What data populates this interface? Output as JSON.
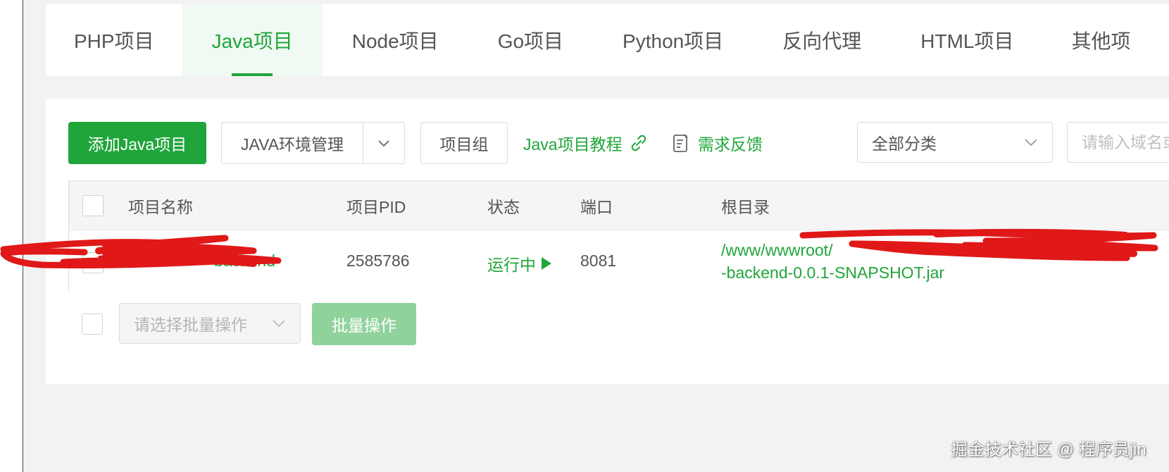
{
  "tabs": [
    {
      "label": "PHP项目",
      "active": false
    },
    {
      "label": "Java项目",
      "active": true
    },
    {
      "label": "Node项目",
      "active": false
    },
    {
      "label": "Go项目",
      "active": false
    },
    {
      "label": "Python项目",
      "active": false
    },
    {
      "label": "反向代理",
      "active": false
    },
    {
      "label": "HTML项目",
      "active": false
    },
    {
      "label": "其他项",
      "active": false
    }
  ],
  "toolbar": {
    "add_button": "添加Java项目",
    "env_manage": "JAVA环境管理",
    "project_group": "项目组",
    "tutorial_link": "Java项目教程",
    "feedback_link": "需求反馈",
    "category_select": "全部分类",
    "search_placeholder": "请输入域名或"
  },
  "table": {
    "headers": {
      "name": "项目名称",
      "pid": "项目PID",
      "status": "状态",
      "port": "端口",
      "root": "根目录"
    },
    "rows": [
      {
        "name": "backend",
        "pid": "2585786",
        "status": "运行中",
        "port": "8081",
        "root_line1": "/www/wwwroot/",
        "root_line2": "-backend-0.0.1-SNAPSHOT.jar"
      }
    ]
  },
  "batch": {
    "select_placeholder": "请选择批量操作",
    "button": "批量操作"
  },
  "watermark": "掘金技术社区 @ 程序员jin",
  "colors": {
    "primary": "#20a53a",
    "primary_disabled": "#90d29c",
    "redaction": "#e01818"
  },
  "icons": {
    "dropdown": "chevron-down-icon",
    "link": "link-icon",
    "feedback": "edit-document-icon",
    "running": "play-triangle-icon"
  }
}
